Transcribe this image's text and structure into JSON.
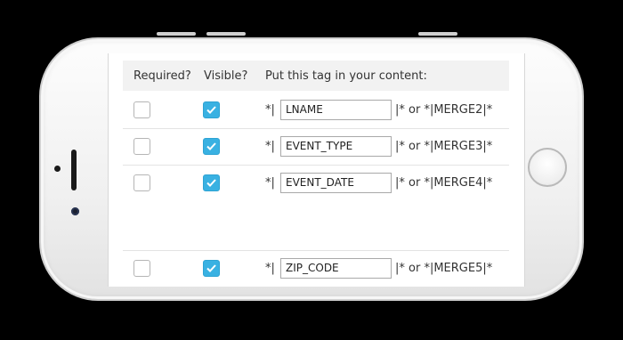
{
  "headers": {
    "required": "Required?",
    "visible": "Visible?",
    "tag": "Put this tag in your content:"
  },
  "rows": [
    {
      "required": false,
      "visible": true,
      "prefix": "*|",
      "tag": "LNAME",
      "suffix": "|* or *|MERGE2|*"
    },
    {
      "required": false,
      "visible": true,
      "prefix": "*|",
      "tag": "EVENT_TYPE",
      "suffix": "|* or *|MERGE3|*"
    },
    {
      "required": false,
      "visible": true,
      "prefix": "*|",
      "tag": "EVENT_DATE",
      "suffix": "|* or *|MERGE4|*"
    },
    {
      "required": false,
      "visible": true,
      "prefix": "*|",
      "tag": "ZIP_CODE",
      "suffix": "|* or *|MERGE5|*"
    }
  ],
  "colors": {
    "checkbox_checked": "#39b1e2",
    "header_bg": "#f2f2f2",
    "text": "#333333"
  }
}
